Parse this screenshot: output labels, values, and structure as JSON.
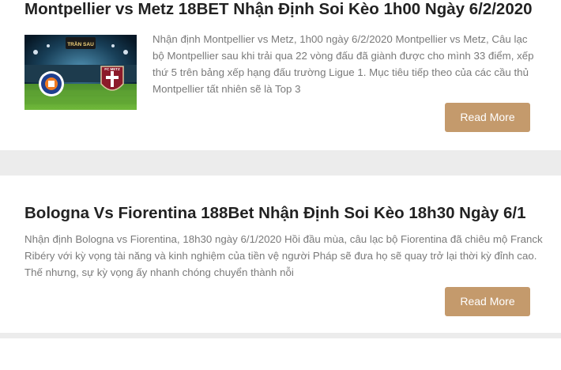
{
  "posts": [
    {
      "title": "Montpellier vs Metz 18BET Nhận Định Soi Kèo 1h00 Ngày 6/2/2020",
      "excerpt": "Nhận định Montpellier vs Metz, 1h00 ngày 6/2/2020 Montpellier vs Metz, Câu lạc bộ Montpellier sau khi trải qua 22 vòng đấu đã giành được cho mình 33 điểm, xếp thứ 5 trên bảng xếp hạng đấu trường Ligue 1. Mục tiêu tiếp theo của các cầu thủ Montpellier tất nhiên sẽ là Top 3",
      "button_label": "Read More",
      "thumbnail": {
        "logo_text": "TRẦN SAU",
        "right_badge_text": "FC METZ"
      }
    },
    {
      "title": "Bologna Vs Fiorentina 188Bet Nhận Định Soi Kèo 18h30 Ngày 6/1",
      "excerpt": "Nhận định Bologna vs Fiorentina, 18h30 ngày 6/1/2020 Hồi đầu mùa, câu lạc bộ Fiorentina đã chiêu mộ Franck Ribéry với kỳ vọng tài năng và kinh nghiệm của tiền vệ người Pháp sẽ đưa họ sẽ quay trở lại thời kỳ đỉnh cao. Thế nhưng, sự kỳ vọng ấy nhanh chóng chuyển thành nỗi",
      "button_label": "Read More"
    }
  ],
  "colors": {
    "button": "#c49a6c",
    "title": "#222222",
    "excerpt": "#7a7a7a",
    "background": "#ececec"
  }
}
